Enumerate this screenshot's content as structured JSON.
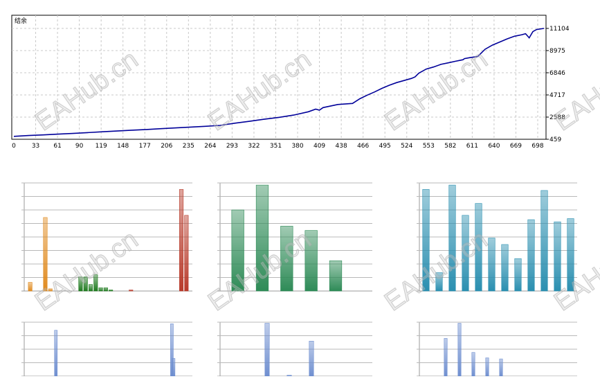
{
  "watermark": "EAHub.cn",
  "chart_data": [
    {
      "type": "line",
      "title": "结余",
      "color": "#000099",
      "x_ticks": [
        "0",
        "33",
        "61",
        "90",
        "119",
        "148",
        "177",
        "206",
        "235",
        "264",
        "293",
        "322",
        "351",
        "380",
        "409",
        "438",
        "466",
        "495",
        "524",
        "553",
        "582",
        "611",
        "640",
        "669",
        "698"
      ],
      "y_ticks": [
        "459",
        "2588",
        "4717",
        "6846",
        "8975",
        "11104"
      ],
      "ylim": [
        459,
        11104
      ],
      "xlim": [
        0,
        720
      ],
      "grid": true,
      "series": [
        {
          "x": [
            0,
            20,
            40,
            60,
            80,
            100,
            120,
            140,
            160,
            180,
            200,
            220,
            240,
            260,
            280,
            300,
            320,
            340,
            360,
            380,
            400,
            410,
            415,
            420,
            440,
            460,
            470,
            480,
            490,
            500,
            510,
            520,
            530,
            540,
            545,
            550,
            555,
            560,
            570,
            580,
            590,
            600,
            610,
            612,
            620,
            630,
            640,
            650,
            660,
            670,
            680,
            690,
            695,
            700,
            705,
            710,
            720
          ],
          "y": [
            740,
            820,
            880,
            950,
            1020,
            1100,
            1180,
            1250,
            1330,
            1400,
            1480,
            1550,
            1630,
            1700,
            1790,
            2000,
            2180,
            2380,
            2560,
            2780,
            3100,
            3350,
            3250,
            3500,
            3800,
            3900,
            4350,
            4700,
            5000,
            5350,
            5650,
            5900,
            6100,
            6300,
            6450,
            6800,
            7000,
            7200,
            7400,
            7650,
            7800,
            7950,
            8100,
            8200,
            8300,
            8400,
            9100,
            9500,
            9800,
            10100,
            10350,
            10500,
            10600,
            10200,
            10800,
            11000,
            11104
          ]
        }
      ]
    },
    {
      "type": "bar",
      "colors": [
        "#e08a1e",
        "#1e7a1e",
        "#b83a2a"
      ],
      "series": [
        {
          "values": [
            0.08,
            0,
            0,
            0.68,
            0.02,
            0,
            0,
            0,
            0,
            0,
            0,
            0,
            0,
            0,
            0,
            0,
            0,
            0,
            0,
            0,
            0,
            0,
            0,
            0,
            0,
            0,
            0,
            0,
            0,
            0,
            0,
            0
          ]
        },
        {
          "values": [
            0,
            0,
            0,
            0,
            0,
            0,
            0,
            0,
            0,
            0,
            0.13,
            0.13,
            0.06,
            0.15,
            0.03,
            0.03,
            0.01,
            0,
            0,
            0,
            0,
            0,
            0,
            0,
            0,
            0,
            0,
            0,
            0,
            0,
            0,
            0
          ]
        },
        {
          "values": [
            0,
            0,
            0,
            0,
            0,
            0,
            0,
            0,
            0,
            0,
            0,
            0,
            0,
            0,
            0,
            0,
            0,
            0,
            0,
            0,
            0.01,
            0,
            0,
            0,
            0,
            0,
            0,
            0,
            0,
            0,
            0.94,
            0.7
          ]
        }
      ]
    },
    {
      "type": "bar",
      "color": "#2e8b57",
      "values": [
        0.75,
        0.98,
        0.6,
        0.56,
        0.28,
        0
      ]
    },
    {
      "type": "bar",
      "color": "#2a8fb0",
      "values": [
        0.94,
        0.17,
        0.98,
        0.7,
        0.81,
        0.49,
        0.43,
        0.3,
        0.66,
        0.93,
        0.64,
        0.67
      ]
    },
    {
      "type": "bar",
      "color": "#6f8fd0",
      "values": [
        0,
        0,
        0,
        0,
        0,
        0,
        0,
        0,
        0,
        0,
        0,
        0,
        0,
        0,
        0,
        0,
        0,
        0,
        0,
        0,
        0,
        0,
        0,
        0,
        0,
        0,
        0,
        0,
        0,
        0,
        0,
        0,
        0,
        0,
        0,
        0
      ],
      "bars": [
        [
          0.18,
          0.85
        ],
        [
          0.87,
          0.97
        ],
        [
          0.88,
          0.33
        ]
      ]
    },
    {
      "type": "bar",
      "color": "#6f8fd0",
      "values": [
        0,
        0.98,
        0.02,
        0.65,
        0
      ]
    },
    {
      "type": "bar",
      "color": "#6f8fd0",
      "values": [
        0,
        0.7,
        0.98,
        0.44,
        0.34,
        0.32,
        0
      ]
    }
  ]
}
